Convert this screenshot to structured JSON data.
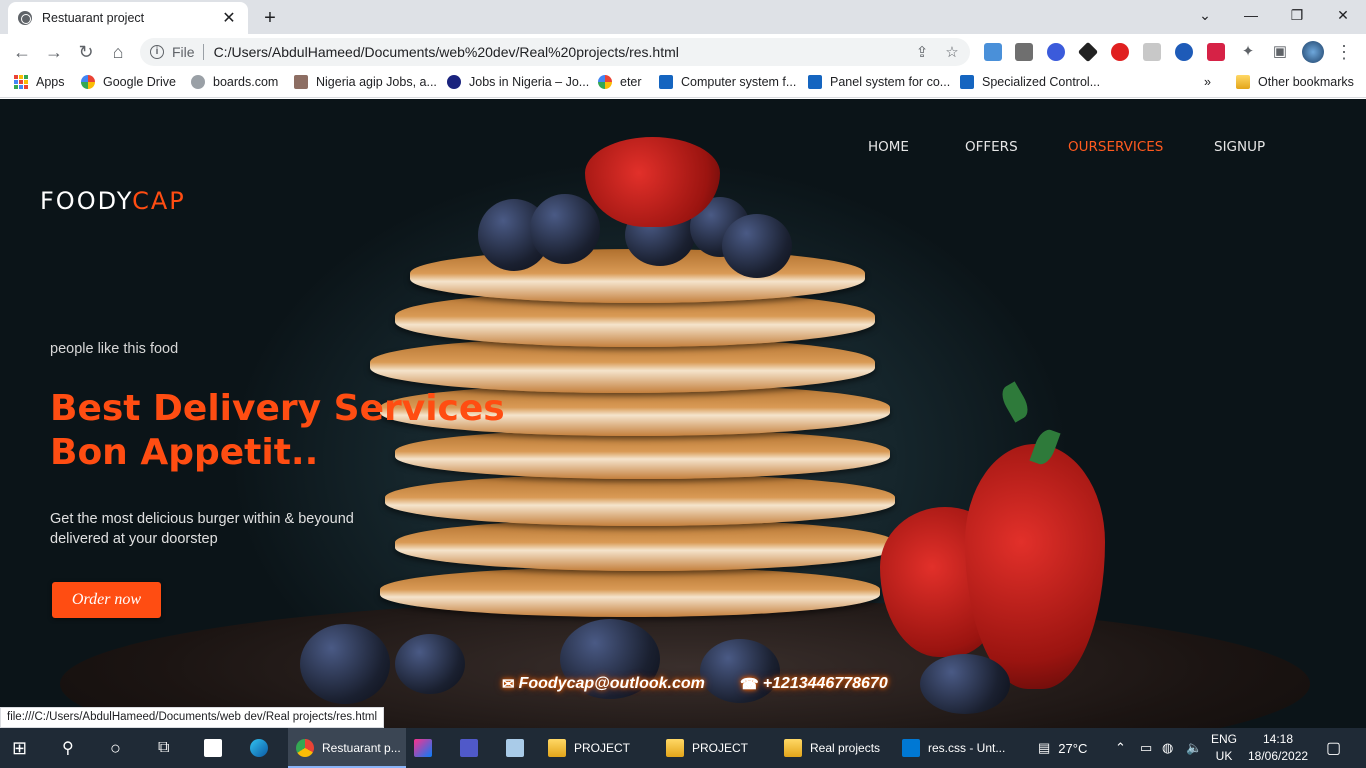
{
  "browser": {
    "tab_title": "Restuarant project",
    "tab_close": "✕",
    "new_tab": "+",
    "window_controls": [
      "—",
      "❐",
      "✕"
    ],
    "scheme": "File",
    "url": "C:/Users/AbdulHameed/Documents/web%20dev/Real%20projects/res.html",
    "bookmarks": [
      "Apps",
      "Google Drive",
      "boards.com",
      "Nigeria agip Jobs, a...",
      "Jobs in Nigeria – Jo...",
      "eter",
      "Computer system f...",
      "Panel system for co...",
      "Specialized Control..."
    ],
    "bookmarks_more": "»",
    "other_bookmarks": "Other bookmarks",
    "status_url": "file:///C:/Users/AbdulHameed/Documents/web dev/Real projects/res.html"
  },
  "site": {
    "brand_main": "FOODY",
    "brand_accent": "CAP",
    "nav": [
      "HOME",
      "OFFERS",
      "OURSERVICES",
      "SIGNUP"
    ],
    "active_nav": "OURSERVICES",
    "tagline": "people like this food",
    "headline_line1": "Best Delivery Services",
    "headline_line2": "Bon Appetit..",
    "subtext": "Get the most delicious burger within & beyound delivered at your doorstep",
    "cta": "Order now",
    "email": "Foodycap@outlook.com",
    "phone": "+1213446778670",
    "accent_color": "#ff4d12"
  },
  "taskbar": {
    "apps": [
      "Restuarant p...",
      "PROJECT",
      "PROJECT",
      "Real projects",
      "res.css - Unt..."
    ],
    "weather": "27°C",
    "language_1": "ENG",
    "language_2": "UK",
    "time": "14:18",
    "date": "18/06/2022"
  }
}
